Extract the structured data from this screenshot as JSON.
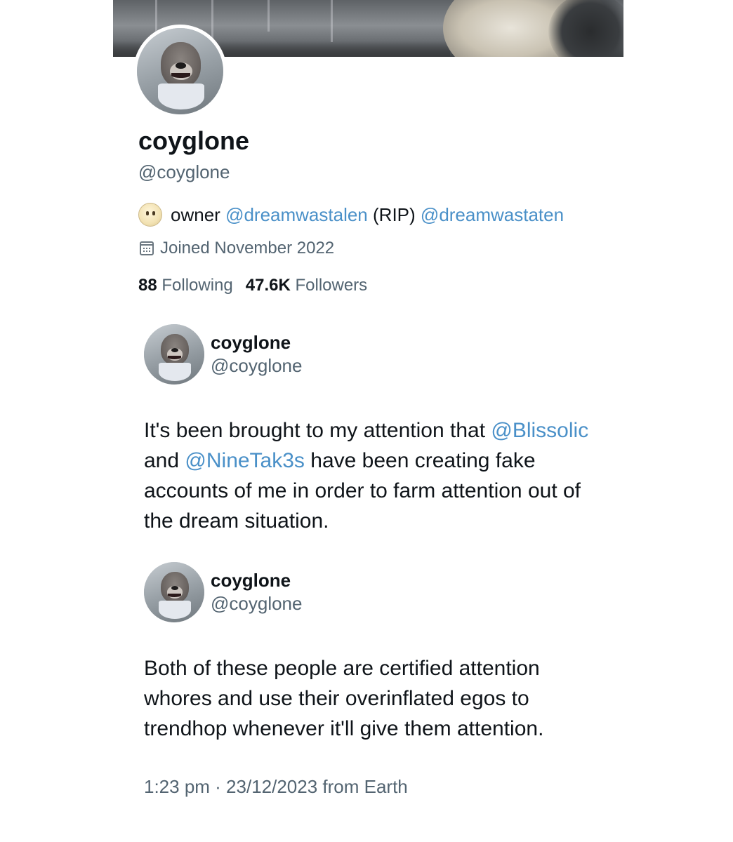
{
  "profile": {
    "display_name": "coyglone",
    "handle": "@coyglone",
    "bio": {
      "prefix": "owner",
      "mention1": "@dreamwastalen",
      "middle": "(RIP)",
      "mention2": "@dreamwastaten"
    },
    "joined": "Joined November 2022",
    "following_count": "88",
    "following_label": "Following",
    "followers_count": "47.6K",
    "followers_label": "Followers"
  },
  "tweets": [
    {
      "author_name": "coyglone",
      "author_handle": "@coyglone",
      "text_segments": {
        "part1": "It's been brought to my attention that",
        "mention1": "@Blissolic",
        "and": "and",
        "mention2": "@NineTak3s",
        "part2": "have been creating fake accounts of me in order to farm attention out of the dream situation."
      }
    },
    {
      "author_name": "coyglone",
      "author_handle": "@coyglone",
      "text": "Both of these people are certified attention whores and use their overinflated egos to trendhop whenever it'll give them attention."
    }
  ],
  "timestamp": "1:23 pm · 23/12/2023 from Earth",
  "colors": {
    "link": "#4a90c8",
    "secondary_text": "#536471",
    "primary_text": "#0f1419"
  },
  "icons": {
    "bio_emoji": "face-emoji-icon",
    "joined": "calendar-icon"
  }
}
